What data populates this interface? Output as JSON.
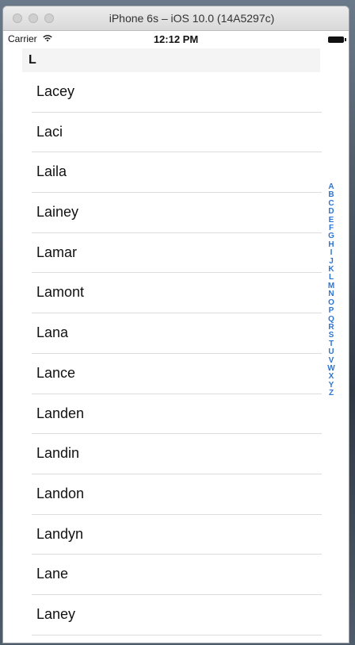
{
  "window": {
    "title": "iPhone 6s – iOS 10.0 (14A5297c)"
  },
  "status_bar": {
    "carrier": "Carrier",
    "time": "12:12 PM",
    "wifi_icon": "wifi-icon",
    "battery_icon": "battery-icon"
  },
  "section": {
    "letter": "L"
  },
  "names": [
    "Lacey",
    "Laci",
    "Laila",
    "Lainey",
    "Lamar",
    "Lamont",
    "Lana",
    "Lance",
    "Landen",
    "Landin",
    "Landon",
    "Landyn",
    "Lane",
    "Laney"
  ],
  "index_letters": [
    "A",
    "B",
    "C",
    "D",
    "E",
    "F",
    "G",
    "H",
    "I",
    "J",
    "K",
    "L",
    "M",
    "N",
    "O",
    "P",
    "Q",
    "R",
    "S",
    "T",
    "U",
    "V",
    "W",
    "X",
    "Y",
    "Z"
  ],
  "colors": {
    "index": "#2f74d0"
  }
}
